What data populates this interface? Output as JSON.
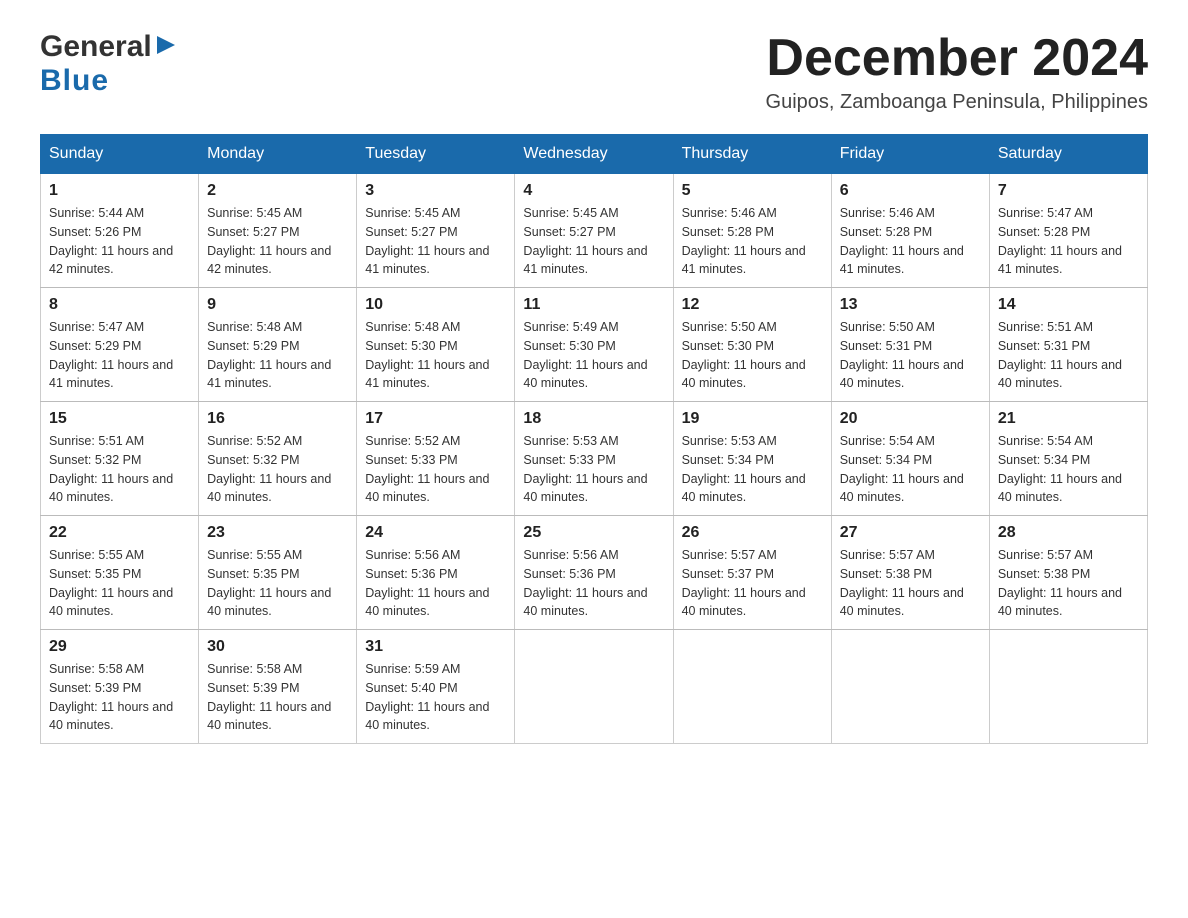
{
  "header": {
    "logo_general": "General",
    "logo_blue": "Blue",
    "month_title": "December 2024",
    "location": "Guipos, Zamboanga Peninsula, Philippines"
  },
  "calendar": {
    "days_of_week": [
      "Sunday",
      "Monday",
      "Tuesday",
      "Wednesday",
      "Thursday",
      "Friday",
      "Saturday"
    ],
    "weeks": [
      [
        {
          "day": "1",
          "sunrise": "5:44 AM",
          "sunset": "5:26 PM",
          "daylight": "11 hours and 42 minutes."
        },
        {
          "day": "2",
          "sunrise": "5:45 AM",
          "sunset": "5:27 PM",
          "daylight": "11 hours and 42 minutes."
        },
        {
          "day": "3",
          "sunrise": "5:45 AM",
          "sunset": "5:27 PM",
          "daylight": "11 hours and 41 minutes."
        },
        {
          "day": "4",
          "sunrise": "5:45 AM",
          "sunset": "5:27 PM",
          "daylight": "11 hours and 41 minutes."
        },
        {
          "day": "5",
          "sunrise": "5:46 AM",
          "sunset": "5:28 PM",
          "daylight": "11 hours and 41 minutes."
        },
        {
          "day": "6",
          "sunrise": "5:46 AM",
          "sunset": "5:28 PM",
          "daylight": "11 hours and 41 minutes."
        },
        {
          "day": "7",
          "sunrise": "5:47 AM",
          "sunset": "5:28 PM",
          "daylight": "11 hours and 41 minutes."
        }
      ],
      [
        {
          "day": "8",
          "sunrise": "5:47 AM",
          "sunset": "5:29 PM",
          "daylight": "11 hours and 41 minutes."
        },
        {
          "day": "9",
          "sunrise": "5:48 AM",
          "sunset": "5:29 PM",
          "daylight": "11 hours and 41 minutes."
        },
        {
          "day": "10",
          "sunrise": "5:48 AM",
          "sunset": "5:30 PM",
          "daylight": "11 hours and 41 minutes."
        },
        {
          "day": "11",
          "sunrise": "5:49 AM",
          "sunset": "5:30 PM",
          "daylight": "11 hours and 40 minutes."
        },
        {
          "day": "12",
          "sunrise": "5:50 AM",
          "sunset": "5:30 PM",
          "daylight": "11 hours and 40 minutes."
        },
        {
          "day": "13",
          "sunrise": "5:50 AM",
          "sunset": "5:31 PM",
          "daylight": "11 hours and 40 minutes."
        },
        {
          "day": "14",
          "sunrise": "5:51 AM",
          "sunset": "5:31 PM",
          "daylight": "11 hours and 40 minutes."
        }
      ],
      [
        {
          "day": "15",
          "sunrise": "5:51 AM",
          "sunset": "5:32 PM",
          "daylight": "11 hours and 40 minutes."
        },
        {
          "day": "16",
          "sunrise": "5:52 AM",
          "sunset": "5:32 PM",
          "daylight": "11 hours and 40 minutes."
        },
        {
          "day": "17",
          "sunrise": "5:52 AM",
          "sunset": "5:33 PM",
          "daylight": "11 hours and 40 minutes."
        },
        {
          "day": "18",
          "sunrise": "5:53 AM",
          "sunset": "5:33 PM",
          "daylight": "11 hours and 40 minutes."
        },
        {
          "day": "19",
          "sunrise": "5:53 AM",
          "sunset": "5:34 PM",
          "daylight": "11 hours and 40 minutes."
        },
        {
          "day": "20",
          "sunrise": "5:54 AM",
          "sunset": "5:34 PM",
          "daylight": "11 hours and 40 minutes."
        },
        {
          "day": "21",
          "sunrise": "5:54 AM",
          "sunset": "5:34 PM",
          "daylight": "11 hours and 40 minutes."
        }
      ],
      [
        {
          "day": "22",
          "sunrise": "5:55 AM",
          "sunset": "5:35 PM",
          "daylight": "11 hours and 40 minutes."
        },
        {
          "day": "23",
          "sunrise": "5:55 AM",
          "sunset": "5:35 PM",
          "daylight": "11 hours and 40 minutes."
        },
        {
          "day": "24",
          "sunrise": "5:56 AM",
          "sunset": "5:36 PM",
          "daylight": "11 hours and 40 minutes."
        },
        {
          "day": "25",
          "sunrise": "5:56 AM",
          "sunset": "5:36 PM",
          "daylight": "11 hours and 40 minutes."
        },
        {
          "day": "26",
          "sunrise": "5:57 AM",
          "sunset": "5:37 PM",
          "daylight": "11 hours and 40 minutes."
        },
        {
          "day": "27",
          "sunrise": "5:57 AM",
          "sunset": "5:38 PM",
          "daylight": "11 hours and 40 minutes."
        },
        {
          "day": "28",
          "sunrise": "5:57 AM",
          "sunset": "5:38 PM",
          "daylight": "11 hours and 40 minutes."
        }
      ],
      [
        {
          "day": "29",
          "sunrise": "5:58 AM",
          "sunset": "5:39 PM",
          "daylight": "11 hours and 40 minutes."
        },
        {
          "day": "30",
          "sunrise": "5:58 AM",
          "sunset": "5:39 PM",
          "daylight": "11 hours and 40 minutes."
        },
        {
          "day": "31",
          "sunrise": "5:59 AM",
          "sunset": "5:40 PM",
          "daylight": "11 hours and 40 minutes."
        },
        null,
        null,
        null,
        null
      ]
    ]
  }
}
